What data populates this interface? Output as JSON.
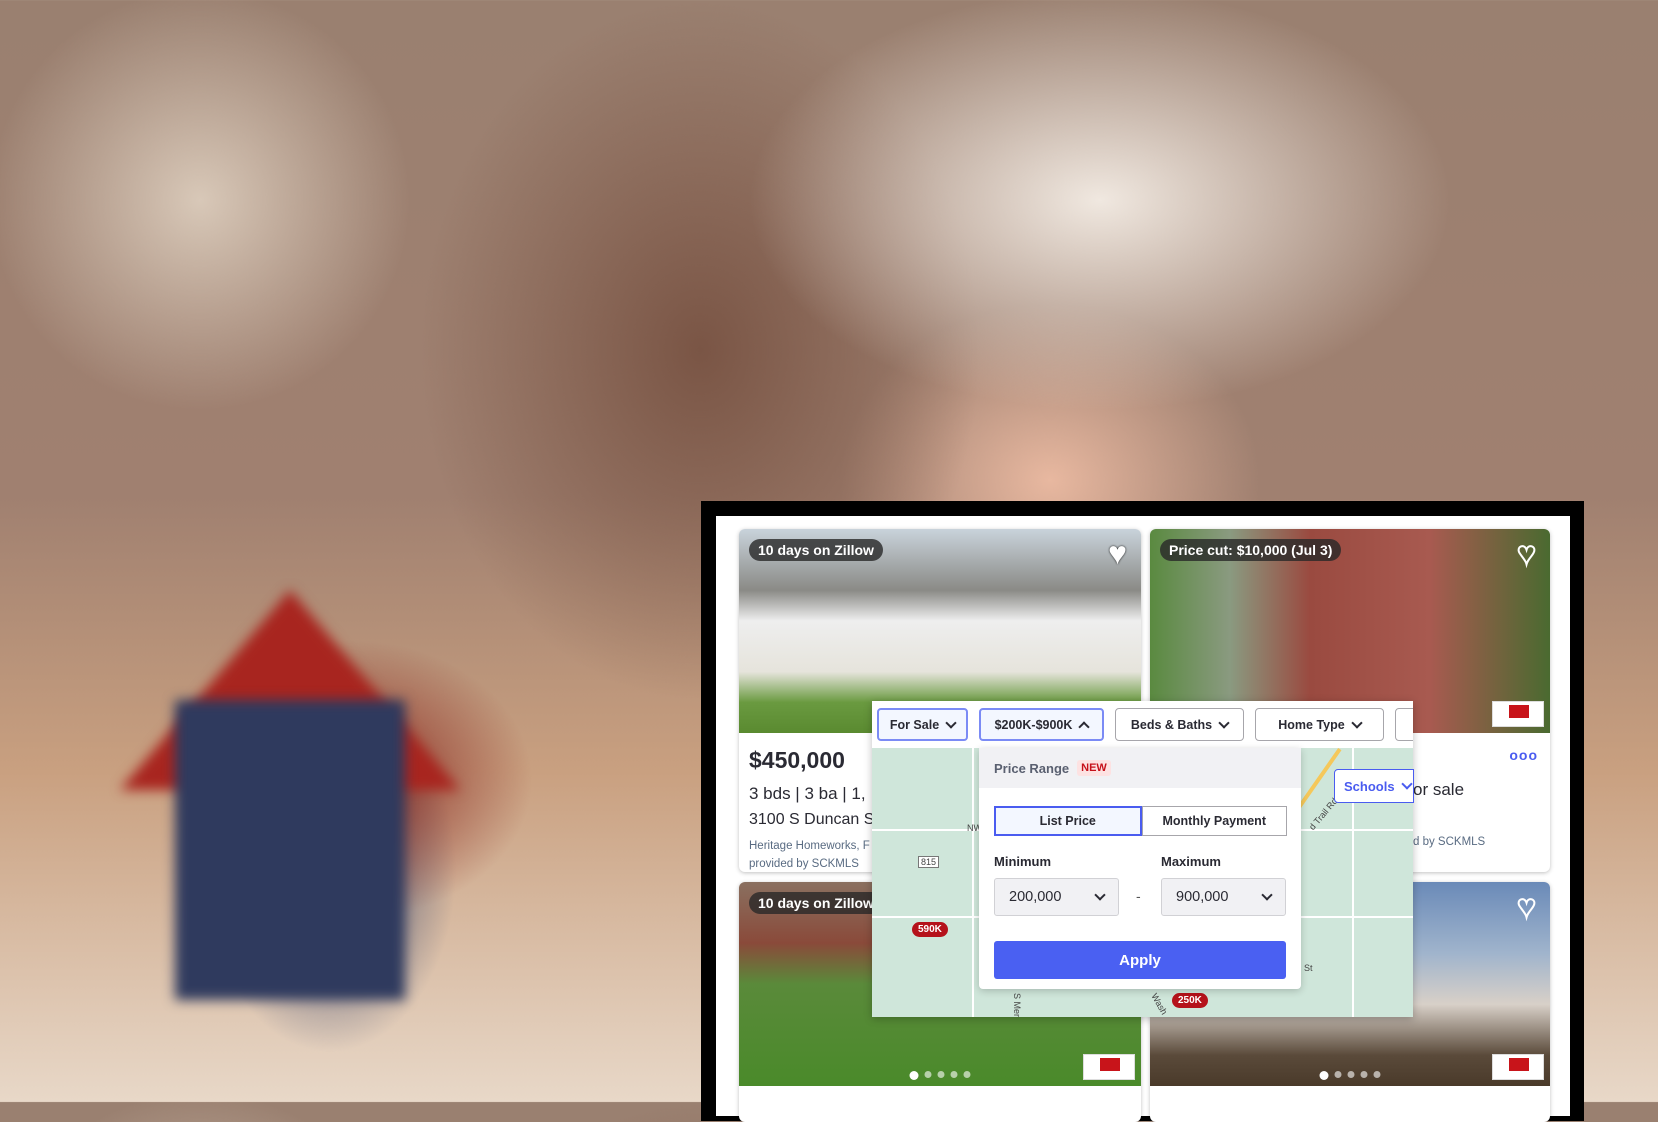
{
  "filters": {
    "for_sale": "For Sale",
    "price": "$200K-$900K",
    "beds_baths": "Beds & Baths",
    "home_type": "Home Type",
    "schools": "Schools"
  },
  "price_dropdown": {
    "title": "Price Range",
    "badge": "NEW",
    "tabs": [
      "List Price",
      "Monthly Payment"
    ],
    "active_tab": "List Price",
    "min_label": "Minimum",
    "max_label": "Maximum",
    "min_value": "200,000",
    "max_value": "900,000",
    "separator": "-",
    "apply": "Apply"
  },
  "map": {
    "pins": [
      "590K",
      "250K"
    ],
    "labels": [
      "815",
      "NW",
      "S Meri",
      "d Trail Rd",
      "St",
      "Wash"
    ]
  },
  "listings": [
    {
      "badge": "10 days on Zillow",
      "price": "$450,000",
      "facts": "3 bds | 3 ba | 1,",
      "address": "3100 S Duncan S",
      "broker": "Heritage Homeworks, F",
      "mls": "provided by SCKMLS"
    },
    {
      "badge": "Price cut: $10,000 (Jul 3)",
      "status": "or sale",
      "mls": "d by SCKMLS",
      "more_icon": "ooo"
    },
    {
      "badge": "10 days on Zillow"
    },
    {}
  ],
  "colors": {
    "accent": "#4a60f2",
    "pin": "#b5121b",
    "new_badge": "#c6101a"
  }
}
